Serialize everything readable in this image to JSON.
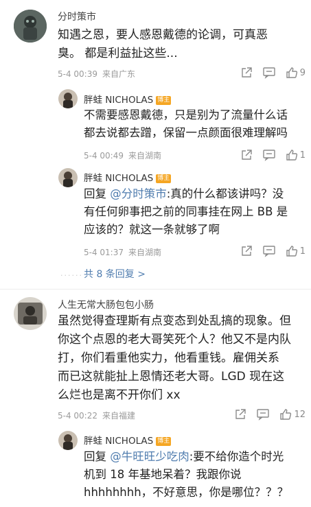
{
  "comments": [
    {
      "username": "分时策市",
      "text_lines": [
        "知遇之恩，要人感恩戴德的论调，可真恶",
        "臭。 都是利益扯这些..."
      ],
      "date": "5-4 00:39",
      "location": "来自广东",
      "likes": "9",
      "replies": [
        {
          "username": "胖蛙 NICHOLAS",
          "badge": "博主",
          "text_lines": [
            "不需要感恩戴德，只是别为了流量什么话",
            "都去说都去蹭，保留一点颜面很难理解吗"
          ],
          "date": "5-4 00:49",
          "location": "来自湖南",
          "likes": "1"
        },
        {
          "username": "胖蛙 NICHOLAS",
          "badge": "博主",
          "reply_prefix": "回复 ",
          "mention": "@分时策市",
          "text_lines": [
            ":真的什么都该讲吗？没",
            "有任何卵事把之前的同事挂在网上 BB 是",
            "应该的？就这一条就够了啊"
          ],
          "date": "5-4 01:37",
          "location": "来自湖南",
          "likes": "1"
        }
      ],
      "more_replies": "共 8 条回复 >",
      "dots": "......"
    },
    {
      "username": "人生无常大肠包包小肠",
      "text_lines": [
        "虽然觉得查理斯有点变态到处乱搞的现象。但",
        "你这个点恩的老大哥笑死个人？他又不是内队",
        "打，你们看重他实力，他看重钱。雇佣关系",
        "而已这就能扯上恩情还老大哥。LGD 现在这",
        "么烂也是离不开你们 xx"
      ],
      "date": "5-4 00:22",
      "location": "来自福建",
      "likes": "12",
      "replies": [
        {
          "username": "胖蛙 NICHOLAS",
          "badge": "博主",
          "reply_prefix": "回复 ",
          "mention": "@牛旺旺少吃肉",
          "text_lines": [
            ":要不给你造个时光",
            "机到 18 年基地呆着？我跟你说",
            "hhhhhhhh，不好意思，你是哪位？？？"
          ]
        }
      ]
    }
  ],
  "icons": [
    "share-icon",
    "comment-icon",
    "like-icon"
  ]
}
